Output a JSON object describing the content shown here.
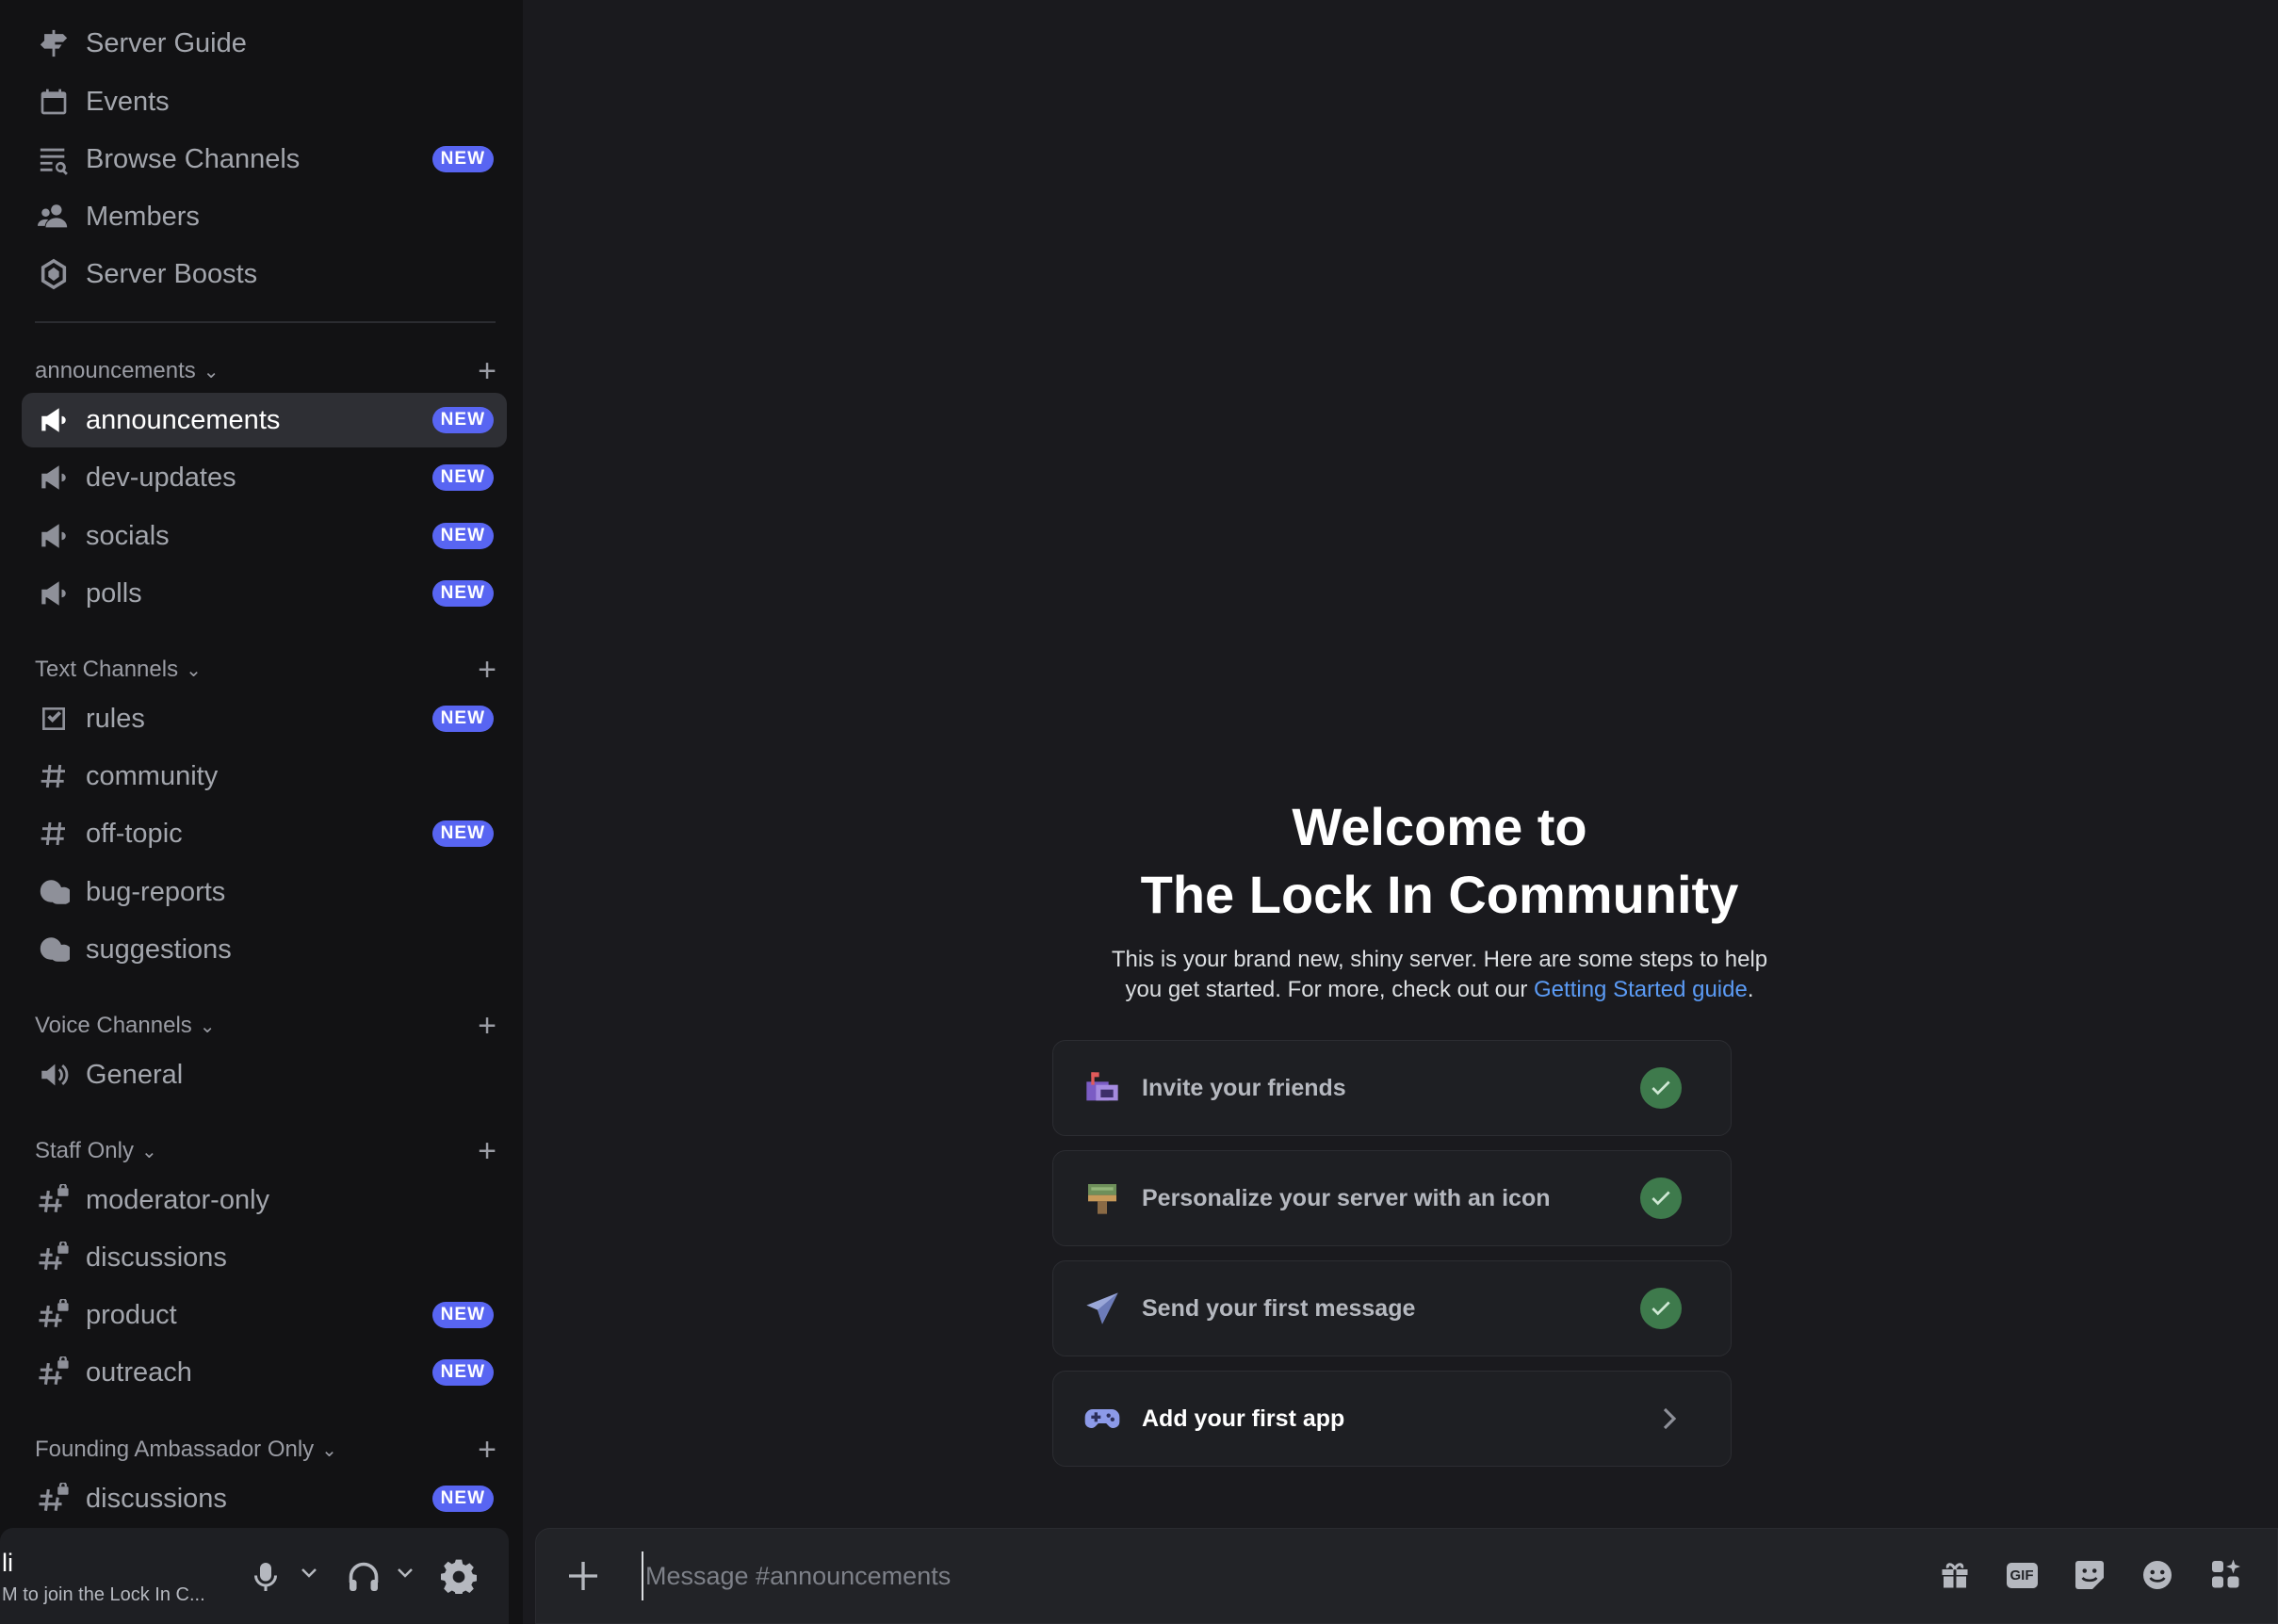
{
  "sidebar": {
    "top_items": [
      {
        "label": "Server Guide",
        "icon": "signpost-icon"
      },
      {
        "label": "Events",
        "icon": "calendar-icon"
      },
      {
        "label": "Browse Channels",
        "icon": "browse-channels-icon",
        "badge": "NEW"
      },
      {
        "label": "Members",
        "icon": "members-icon"
      },
      {
        "label": "Server Boosts",
        "icon": "boost-icon"
      }
    ],
    "categories": [
      {
        "label": "announcements"
      },
      {
        "label": "Text Channels"
      },
      {
        "label": "Voice Channels"
      },
      {
        "label": "Staff Only"
      },
      {
        "label": "Founding Ambassador Only"
      }
    ],
    "channels": [
      {
        "label": "announcements",
        "icon": "megaphone-icon",
        "badge": "NEW"
      },
      {
        "label": "dev-updates",
        "icon": "megaphone-icon",
        "badge": "NEW"
      },
      {
        "label": "socials",
        "icon": "megaphone-icon",
        "badge": "NEW"
      },
      {
        "label": "polls",
        "icon": "megaphone-icon",
        "badge": "NEW"
      },
      {
        "label": "rules",
        "icon": "rules-icon",
        "badge": "NEW"
      },
      {
        "label": "community",
        "icon": "hashtag-icon"
      },
      {
        "label": "off-topic",
        "icon": "hashtag-icon",
        "badge": "NEW"
      },
      {
        "label": "bug-reports",
        "icon": "forum-icon"
      },
      {
        "label": "suggestions",
        "icon": "forum-icon"
      },
      {
        "label": "General",
        "icon": "speaker-icon"
      },
      {
        "label": "moderator-only",
        "icon": "locked-hashtag-icon"
      },
      {
        "label": "discussions",
        "icon": "locked-hashtag-icon"
      },
      {
        "label": "product",
        "icon": "locked-hashtag-icon",
        "badge": "NEW"
      },
      {
        "label": "outreach",
        "icon": "locked-hashtag-icon",
        "badge": "NEW"
      },
      {
        "label": "discussions",
        "icon": "locked-hashtag-icon",
        "badge": "NEW"
      }
    ]
  },
  "user": {
    "name": "li",
    "status": "M to join the Lock In C..."
  },
  "welcome": {
    "title_line1": "Welcome to",
    "title_line2": "The Lock In Community",
    "desc_line1": "This is your brand new, shiny server. Here are some steps to help",
    "desc_line2_pre": "you get started. For more, check out our ",
    "desc_link": "Getting Started guide",
    "desc_line2_post": "."
  },
  "cards": [
    {
      "label": "Invite your friends",
      "done": true
    },
    {
      "label": "Personalize your server with an icon",
      "done": true
    },
    {
      "label": "Send your first message",
      "done": true
    },
    {
      "label": "Add your first app",
      "done": false
    }
  ],
  "composer": {
    "placeholder": "Message #announcements",
    "gif_label": "GIF"
  },
  "colors": {
    "accent": "#5865f2",
    "check": "#3e7a4c",
    "link": "#5b9bf5"
  }
}
